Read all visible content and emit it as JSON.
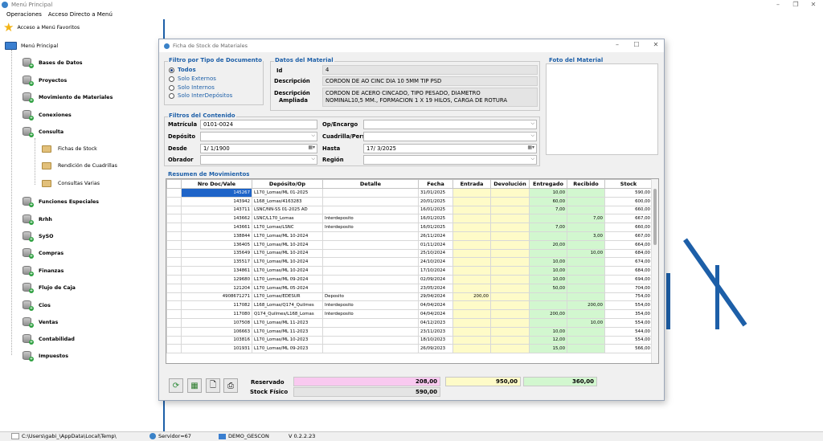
{
  "window": {
    "title": "Menú Principal"
  },
  "menubar": [
    "Operaciones",
    "Acceso Directo a Menú"
  ],
  "sidebar": {
    "favorites": "Acceso a Menú Favoritos",
    "root": "Menú Principal",
    "items": [
      "Bases de Datos",
      "Proyectos",
      "Movimiento de Materiales",
      "Conexiones",
      "Consulta",
      "Fichas de Stock",
      "Rendición de  Cuadrillas",
      "Consultas Varias",
      "Funciones Especiales",
      "Rrhh",
      "SySO",
      "Compras",
      "Finanzas",
      "Flujo de Caja",
      "Cios",
      "Ventas",
      "Contabilidad",
      "Impuestos"
    ]
  },
  "statusbar": {
    "path": "C:\\Users\\gabi_\\AppData\\Local\\Temp\\",
    "server": "Servidor=67",
    "db": "DEMO_GESCON",
    "version": "V 0.2.2.23"
  },
  "dialog": {
    "title": "Ficha de Stock de Materiales",
    "doc_filter": {
      "title": "Filtro por Tipo de Documento",
      "options": [
        "Todos",
        "Solo Externos",
        "Solo Internos",
        "Solo InterDepósitos"
      ],
      "selected": "Todos"
    },
    "material": {
      "title": "Datos del Material",
      "id_label": "Id",
      "id_value": "4",
      "desc_label": "Descripción",
      "desc_value": "CORDON DE AO CINC DIA 10 5MM TIP PSD",
      "ext_label_1": "Descripción",
      "ext_label_2": "Ampliada",
      "ext_value_1": "CORDON DE ACERO CINCADO, TIPO PESADO, DIAMETRO",
      "ext_value_2": "NOMINAL10,5 MM., FORMACION 1 X 19 HILOS, CARGA DE ROTURA"
    },
    "photo_title": "Foto del Material",
    "content_filter": {
      "title": "Filtros del Contenido",
      "matricula_label": "Matrícula",
      "matricula_value": "0101-0024",
      "deposito_label": "Depósito",
      "desde_label": "Desde",
      "desde_value": "1/  1/1900",
      "obrador_label": "Obrador",
      "op_label": "Op/Encargo",
      "cuadrilla_label": "Cuadrilla/Personal",
      "hasta_label": "Hasta",
      "hasta_value": "17/  3/2025",
      "region_label": "Región"
    },
    "movements": {
      "title": "Resumen de Movimientos",
      "columns": [
        "Nro Doc/Vale",
        "Depósito/Op",
        "Detalle",
        "Fecha",
        "Entrada",
        "Devolución",
        "Entregado",
        "Recibido",
        "Stock"
      ],
      "rows": [
        [
          "145267",
          "L170_Lomas/ML 01-2025",
          "",
          "31/01/2025",
          "",
          "",
          "10,00",
          "",
          "590,00"
        ],
        [
          "143942",
          "L168_Lomas/4163283",
          "",
          "20/01/2025",
          "",
          "",
          "60,00",
          "",
          "600,00"
        ],
        [
          "143711",
          "LSNC/NN-SS 01-2025 AD",
          "",
          "16/01/2025",
          "",
          "",
          "7,00",
          "",
          "660,00"
        ],
        [
          "143662",
          "LSNC/L170_Lomas",
          "Interdeposito",
          "16/01/2025",
          "",
          "",
          "",
          "7,00",
          "667,00"
        ],
        [
          "143661",
          "L170_Lomas/LSNC",
          "Interdeposito",
          "16/01/2025",
          "",
          "",
          "7,00",
          "",
          "660,00"
        ],
        [
          "138844",
          "L170_Lomas/ML 10-2024",
          "",
          "26/11/2024",
          "",
          "",
          "",
          "3,00",
          "667,00"
        ],
        [
          "136405",
          "L170_Lomas/ML 10-2024",
          "",
          "01/11/2024",
          "",
          "",
          "20,00",
          "",
          "664,00"
        ],
        [
          "135649",
          "L170_Lomas/ML 10-2024",
          "",
          "25/10/2024",
          "",
          "",
          "",
          "10,00",
          "684,00"
        ],
        [
          "135517",
          "L170_Lomas/ML 10-2024",
          "",
          "24/10/2024",
          "",
          "",
          "10,00",
          "",
          "674,00"
        ],
        [
          "134861",
          "L170_Lomas/ML 10-2024",
          "",
          "17/10/2024",
          "",
          "",
          "10,00",
          "",
          "684,00"
        ],
        [
          "129680",
          "L170_Lomas/ML 09-2024",
          "",
          "02/09/2024",
          "",
          "",
          "10,00",
          "",
          "694,00"
        ],
        [
          "121204",
          "L170_Lomas/ML 05-2024",
          "",
          "23/05/2024",
          "",
          "",
          "50,00",
          "",
          "704,00"
        ],
        [
          "4908671271",
          "L170_Lomas/EDESUR",
          "Deposito",
          "29/04/2024",
          "200,00",
          "",
          "",
          "",
          "754,00"
        ],
        [
          "117082",
          "L168_Lomas/Q174_Quilmes",
          "Interdeposito",
          "04/04/2024",
          "",
          "",
          "",
          "200,00",
          "554,00"
        ],
        [
          "117080",
          "Q174_Quilmes/L168_Lomas",
          "Interdeposito",
          "04/04/2024",
          "",
          "",
          "200,00",
          "",
          "354,00"
        ],
        [
          "107508",
          "L170_Lomas/ML 11-2023",
          "",
          "04/12/2023",
          "",
          "",
          "",
          "10,00",
          "554,00"
        ],
        [
          "106663",
          "L170_Lomas/ML 11-2023",
          "",
          "23/11/2023",
          "",
          "",
          "10,00",
          "",
          "544,00"
        ],
        [
          "103816",
          "L170_Lomas/ML 10-2023",
          "",
          "18/10/2023",
          "",
          "",
          "12,00",
          "",
          "554,00"
        ],
        [
          "101931",
          "L170_Lomas/ML 09-2023",
          "",
          "26/09/2023",
          "",
          "",
          "15,00",
          "",
          "566,00"
        ]
      ]
    },
    "totals": {
      "reservado_label": "Reservado",
      "reservado_value": "208,00",
      "stock_label": "Stock Físico",
      "stock_value": "590,00",
      "entrada_total": "950,00",
      "entregado_total": "360,00"
    },
    "colors": {
      "accent": "#1d5fa8",
      "reservado": "#f9c9f0",
      "entrada": "#fefbc8",
      "entregado": "#d2f7cf"
    }
  }
}
